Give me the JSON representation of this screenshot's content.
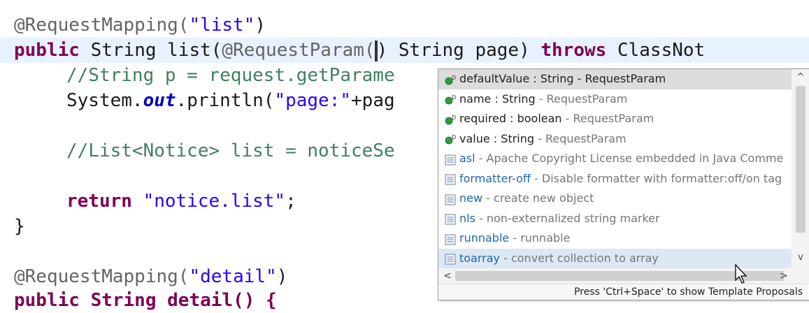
{
  "editor": {
    "line1": {
      "annotation": "@RequestMapping(",
      "string": "\"list\"",
      "close": ")"
    },
    "line2": {
      "kw_public": "public",
      "t1": " String list(",
      "annotation": "@RequestParam(",
      "t2": ")",
      "t3": " String page) ",
      "kw_throws": "throws",
      "t4": " ClassNot"
    },
    "line3": {
      "comment": "//String p = request.getParame"
    },
    "line4": {
      "t1": "System.",
      "field": "out",
      "t2": ".println(",
      "string": "\"page:\"",
      "t3": "+pag"
    },
    "line5": {
      "comment": "//List<Notice> list = noticeSe"
    },
    "line6": {
      "kw_return": "return",
      "space": " ",
      "string": "\"notice.list\"",
      "semi": ";"
    },
    "line7": {
      "brace": "}"
    },
    "line8": {
      "annotation": "@RequestMapping(",
      "string": "\"detail\"",
      "close": ")"
    },
    "line9": {
      "text": "public String detail() {"
    }
  },
  "autocomplete": {
    "items": [
      {
        "icon": "field-icon",
        "name": "defaultValue : String",
        "desc": " - RequestParam"
      },
      {
        "icon": "field-icon",
        "name": "name : String",
        "desc": " - RequestParam"
      },
      {
        "icon": "field-icon",
        "name": "required : boolean",
        "desc": " - RequestParam"
      },
      {
        "icon": "field-icon",
        "name": "value : String",
        "desc": " - RequestParam"
      },
      {
        "icon": "template-icon",
        "name": "asl",
        "desc": " - Apache Copyright License embedded in Java Comme"
      },
      {
        "icon": "template-icon",
        "name": "formatter-off",
        "desc": " - Disable formatter with formatter:off/on tag"
      },
      {
        "icon": "template-icon",
        "name": "new",
        "desc": " - create new object"
      },
      {
        "icon": "template-icon",
        "name": "nls",
        "desc": " - non-externalized string marker"
      },
      {
        "icon": "template-icon",
        "name": "runnable",
        "desc": " - runnable"
      },
      {
        "icon": "template-icon",
        "name": "toarray",
        "desc": " - convert collection to array"
      }
    ],
    "scroll_up": "^",
    "scroll_down": "v",
    "scroll_left": "<",
    "scroll_right": ">",
    "footer": "Press 'Ctrl+Space' to show Template Proposals"
  },
  "colors": {
    "keyword": "#7f0055",
    "string": "#2a00ff",
    "comment": "#3f7f5f",
    "annotation": "#646464",
    "field": "#0000c0",
    "current_line": "#e8f2fe",
    "template_link": "#2266aa"
  }
}
